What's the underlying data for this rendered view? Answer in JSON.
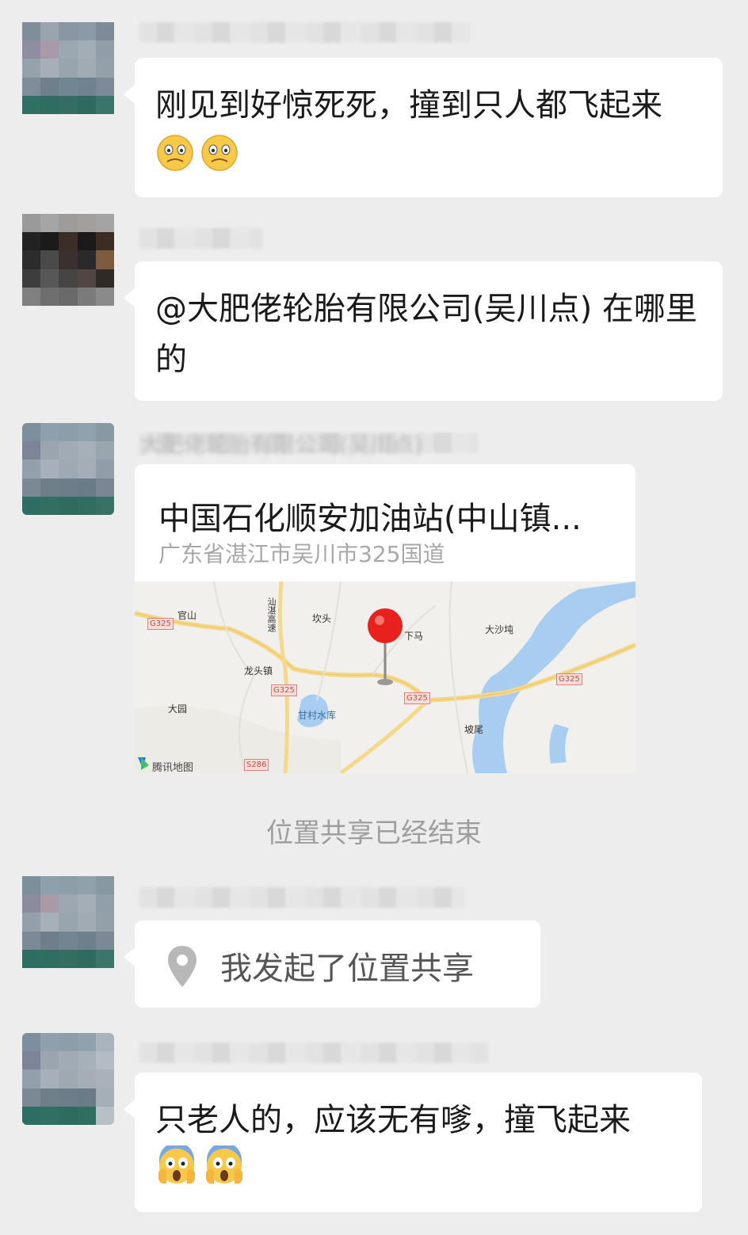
{
  "messages": [
    {
      "text": "刚见到好惊死死，撞到只人都飞起来",
      "emoji": "woozy-face"
    },
    {
      "text": "@大肥佬轮胎有限公司(吴川点) 在哪里的"
    },
    {
      "sender_blurred": "大肥佬轮胎有限公司(吴川点)"
    },
    {
      "share_text": "我发起了位置共享"
    },
    {
      "text": "只老人的，应该无有嗲，撞飞起来",
      "emoji": "screaming-face"
    }
  ],
  "location": {
    "title": "中国石化顺安加油站(中山镇...",
    "address": "广东省湛江市吴川市325国道",
    "map_labels": {
      "guanshan": "官山",
      "kantou": "坎头",
      "xiama": "下马",
      "dashadun": "大沙坉",
      "longtou": "龙头镇",
      "dayuan": "大园",
      "gancun": "甘村水库",
      "powei": "坡尾",
      "expressway": "汕湛高速",
      "brand": "腾讯地图",
      "g325": "G325",
      "s286": "S286"
    }
  },
  "system_notice": "位置共享已经结束",
  "colors": {
    "background": "#ededed",
    "bubble": "#ffffff",
    "pin": "#e8201e",
    "water": "#a9cdf0",
    "road": "#f5d98b"
  }
}
